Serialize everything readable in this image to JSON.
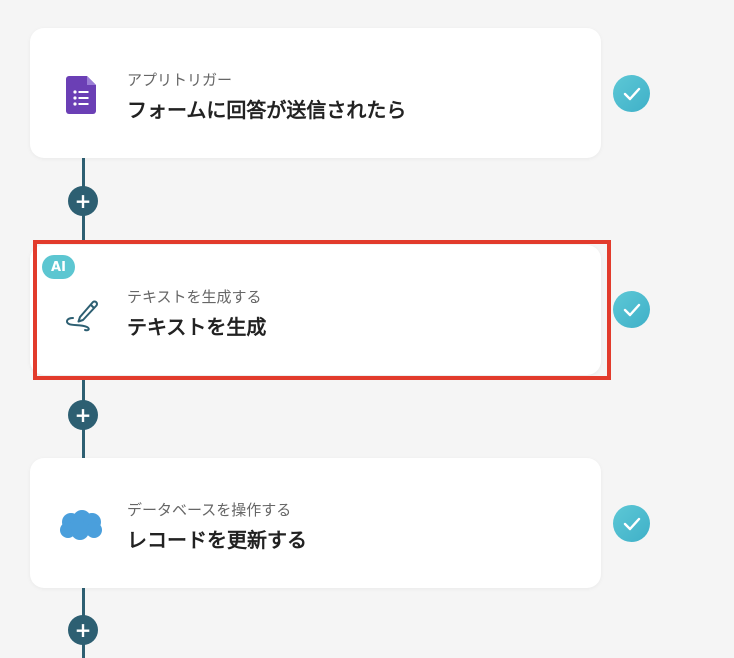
{
  "steps": [
    {
      "subtitle": "アプリトリガー",
      "title": "フォームに回答が送信されたら",
      "icon": "google-forms-icon"
    },
    {
      "subtitle": "テキストを生成する",
      "title": "テキストを生成",
      "icon": "pen-icon",
      "badge": "AI"
    },
    {
      "subtitle": "データベースを操作する",
      "title": "レコードを更新する",
      "icon": "salesforce-cloud-icon"
    }
  ],
  "add_button_symbol": "+",
  "colors": {
    "connector": "#2d5f72",
    "check": "#4fbcd0",
    "highlight": "#e23b2c",
    "ai_badge": "#5cc6d1",
    "forms_purple": "#6b3fb5",
    "salesforce_blue": "#4a9fdc"
  }
}
